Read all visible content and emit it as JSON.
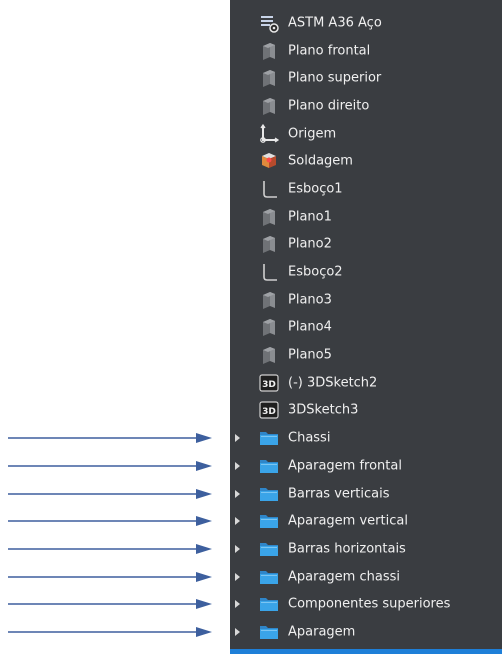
{
  "tree": {
    "items": [
      {
        "label": "ASTM A36 Aço",
        "icon": "material-icon"
      },
      {
        "label": "Plano frontal",
        "icon": "plane-icon"
      },
      {
        "label": "Plano superior",
        "icon": "plane-icon"
      },
      {
        "label": "Plano direito",
        "icon": "plane-icon"
      },
      {
        "label": "Origem",
        "icon": "origin-icon"
      },
      {
        "label": "Soldagem",
        "icon": "weldment-icon"
      },
      {
        "label": "Esboço1",
        "icon": "sketch-icon"
      },
      {
        "label": "Plano1",
        "icon": "plane-icon"
      },
      {
        "label": "Plano2",
        "icon": "plane-icon"
      },
      {
        "label": "Esboço2",
        "icon": "sketch-icon"
      },
      {
        "label": "Plano3",
        "icon": "plane-icon"
      },
      {
        "label": "Plano4",
        "icon": "plane-icon"
      },
      {
        "label": "Plano5",
        "icon": "plane-icon"
      },
      {
        "label": "(-) 3DSketch2",
        "icon": "sketch3d-icon"
      },
      {
        "label": "3DSketch3",
        "icon": "sketch3d-icon"
      },
      {
        "label": "Chassi",
        "icon": "folder-icon",
        "expandable": true
      },
      {
        "label": "Aparagem frontal",
        "icon": "folder-icon",
        "expandable": true
      },
      {
        "label": "Barras verticais",
        "icon": "folder-icon",
        "expandable": true
      },
      {
        "label": "Aparagem vertical",
        "icon": "folder-icon",
        "expandable": true
      },
      {
        "label": "Barras horizontais",
        "icon": "folder-icon",
        "expandable": true
      },
      {
        "label": "Aparagem chassi",
        "icon": "folder-icon",
        "expandable": true
      },
      {
        "label": "Componentes superiores",
        "icon": "folder-icon",
        "expandable": true
      },
      {
        "label": "Aparagem",
        "icon": "folder-icon",
        "expandable": true
      }
    ]
  },
  "annotations": {
    "arrow_color": "#3d5f9e",
    "arrow_count": 8
  },
  "colors": {
    "panel_bg": "#3a3d41",
    "text": "#f0f0f0",
    "folder": "#3aa4e8",
    "selection_bar": "#1e7fd8"
  }
}
